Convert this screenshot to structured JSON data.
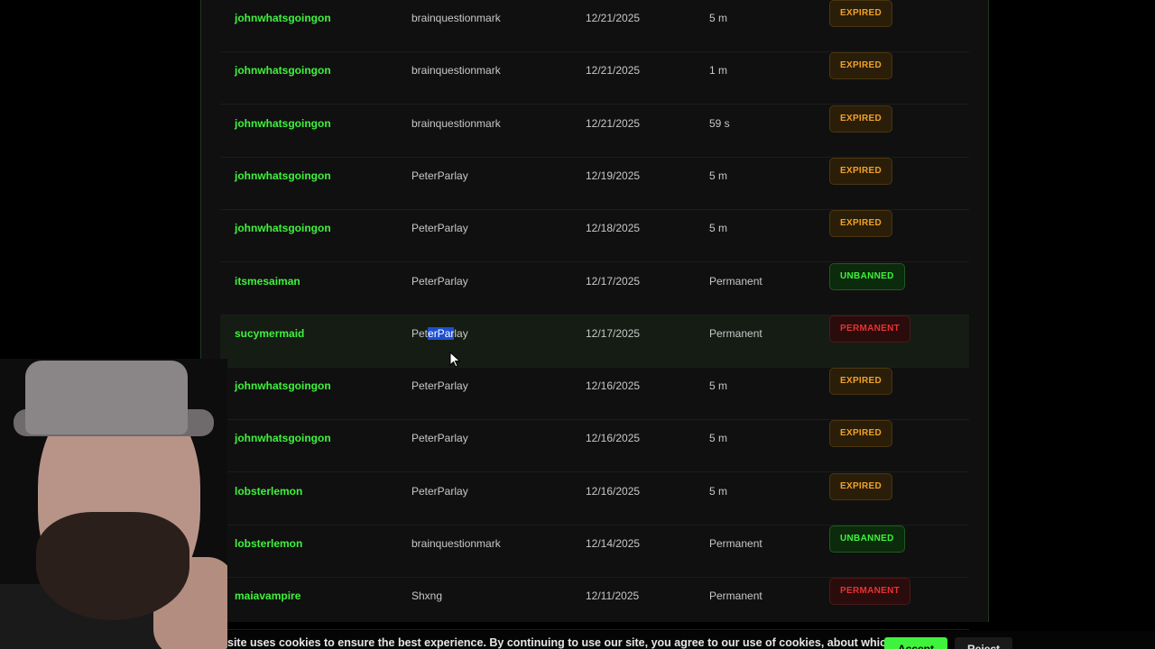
{
  "rows": [
    {
      "user": "johnwhatsgoingon",
      "moderator": "brainquestionmark",
      "date": "12/21/2025",
      "duration": "5 m",
      "status": "EXPIRED",
      "status_type": "expired"
    },
    {
      "user": "johnwhatsgoingon",
      "moderator": "brainquestionmark",
      "date": "12/21/2025",
      "duration": "1 m",
      "status": "EXPIRED",
      "status_type": "expired"
    },
    {
      "user": "johnwhatsgoingon",
      "moderator": "brainquestionmark",
      "date": "12/21/2025",
      "duration": "59 s",
      "status": "EXPIRED",
      "status_type": "expired"
    },
    {
      "user": "johnwhatsgoingon",
      "moderator": "PeterParlay",
      "date": "12/19/2025",
      "duration": "5 m",
      "status": "EXPIRED",
      "status_type": "expired"
    },
    {
      "user": "johnwhatsgoingon",
      "moderator": "PeterParlay",
      "date": "12/18/2025",
      "duration": "5 m",
      "status": "EXPIRED",
      "status_type": "expired"
    },
    {
      "user": "itsmesaiman",
      "moderator": "PeterParlay",
      "date": "12/17/2025",
      "duration": "Permanent",
      "status": "UNBANNED",
      "status_type": "unbanned"
    },
    {
      "user": "sucymermaid",
      "moderator": "PeterParlay",
      "date": "12/17/2025",
      "duration": "Permanent",
      "status": "PERMANENT",
      "status_type": "permanent",
      "moderator_parts": [
        "Pet",
        "erPar",
        "lay"
      ]
    },
    {
      "user": "johnwhatsgoingon",
      "moderator": "PeterParlay",
      "date": "12/16/2025",
      "duration": "5 m",
      "status": "EXPIRED",
      "status_type": "expired"
    },
    {
      "user": "johnwhatsgoingon",
      "moderator": "PeterParlay",
      "date": "12/16/2025",
      "duration": "5 m",
      "status": "EXPIRED",
      "status_type": "expired"
    },
    {
      "user": "lobsterlemon",
      "moderator": "PeterParlay",
      "date": "12/16/2025",
      "duration": "5 m",
      "status": "EXPIRED",
      "status_type": "expired"
    },
    {
      "user": "lobsterlemon",
      "moderator": "brainquestionmark",
      "date": "12/14/2025",
      "duration": "Permanent",
      "status": "UNBANNED",
      "status_type": "unbanned"
    },
    {
      "user": "maiavampire",
      "moderator": "Shxng",
      "date": "12/11/2025",
      "duration": "Permanent",
      "status": "PERMANENT",
      "status_type": "permanent"
    }
  ],
  "cookie_banner": {
    "text": "site uses cookies to ensure the best experience. By continuing to use our site, you agree to our use of cookies, about which you can",
    "accept_label": "Accept",
    "reject_label": "Reject"
  },
  "colors": {
    "username": "#3ff23c",
    "expired": "#f0a22a",
    "unbanned": "#3ff23c",
    "permanent": "#e83232",
    "selection": "#1d4fd1"
  }
}
